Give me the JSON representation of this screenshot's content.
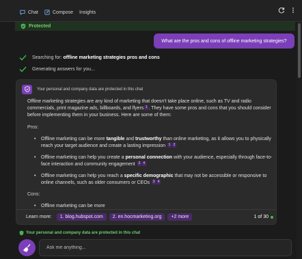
{
  "nav": {
    "tabs": [
      {
        "label": "Chat",
        "icon": "chat-icon"
      },
      {
        "label": "Compose",
        "icon": "compose-icon"
      },
      {
        "label": "Insights"
      }
    ],
    "actions": [
      "refresh-icon",
      "more-icon"
    ]
  },
  "protected_label": "Protected",
  "user_message": "What are the pros and cons of offline marketing strategies?",
  "progress": {
    "searching_prefix": "Searching for: ",
    "searching_query": "offline marketing strategies pros and cons",
    "generating": "Generating answers for you..."
  },
  "card": {
    "privacy_note": "Your personal and company data are protected in this chat",
    "intro_before": "Offline marketing strategies are any kind of marketing that doesn't take place online, such as TV and radio commercials, print magazine ads, billboards, and flyers",
    "intro_cite": "1",
    "intro_after": ". They have some pros and cons that you should consider before implementing them in your business. Here are some of them:",
    "pros_heading": "Pros:",
    "pros": [
      {
        "a": "Offline marketing can be more ",
        "b1": "tangible",
        "m": " and ",
        "b2": "trustworthy",
        "c": " than online marketing, as it allows you to physically reach your target audience and create a lasting impression",
        "cites": [
          "1",
          "2"
        ]
      },
      {
        "a": "Offline marketing can help you create a ",
        "b1": "personal connection",
        "c": " with your audience, especially through face-to-face interaction and community engagement",
        "cites": [
          "3",
          "4"
        ]
      },
      {
        "a": "Offline marketing can help you reach a ",
        "b1": "specific demographic",
        "c": " that may not be accessible or responsive to online channels, such as older consumers or CEOs",
        "cites": [
          "3",
          "4"
        ]
      }
    ],
    "cons_heading": "Cons:",
    "cons": [
      {
        "text": "Offline marketing can be more"
      }
    ],
    "learn_more_label": "Learn more:",
    "sources": [
      "1. blog.hubspot.com",
      "2. en.hocmarketing.org",
      "+2 more"
    ],
    "turn_count": "1 of 30"
  },
  "footer_notice": "Your personal and company data are protected in this chat",
  "input": {
    "placeholder": "Ask me anything..."
  },
  "colors": {
    "accent": "#7b3fb8",
    "protected_green": "#6fcf6f",
    "background": "#1b1b1b",
    "card": "#2b2b2b"
  }
}
